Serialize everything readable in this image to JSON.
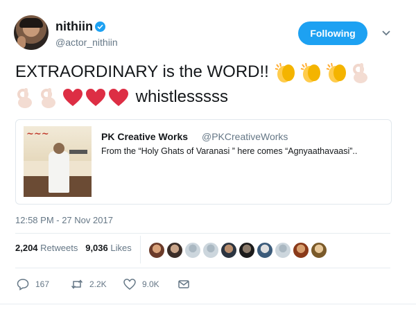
{
  "author": {
    "display_name": "nithiin",
    "handle": "@actor_nithiin",
    "verified": true,
    "avatar_icon": "avatar"
  },
  "follow_button": {
    "label": "Following",
    "color": "#1da1f2"
  },
  "more_menu_icon": "chevron-down-icon",
  "tweet": {
    "line1_text": "EXTRAORDINARY is the WORD!!",
    "line2_text": "whistlesssss",
    "emojis": [
      "clapping-hands",
      "clapping-hands",
      "clapping-hands",
      "ok-hand",
      "ok-hand",
      "ok-hand",
      "red-heart",
      "red-heart",
      "red-heart"
    ]
  },
  "quoted_tweet": {
    "name": "PK Creative Works",
    "handle": "@PKCreativeWorks",
    "text": "From the “Holy Ghats of Varanasi ” here comes “Agnyaathavaasi”..",
    "image_icon": "movie-poster-thumbnail"
  },
  "timestamp": "12:58 PM - 27 Nov 2017",
  "stats": {
    "retweets_count": "2,204",
    "retweets_label": "Retweets",
    "likes_count": "9,036",
    "likes_label": "Likes",
    "liker_avatars": 10
  },
  "actions": {
    "reply_count": "167",
    "retweet_count": "2.2K",
    "like_count": "9.0K",
    "reply_icon": "reply-icon",
    "retweet_icon": "retweet-icon",
    "like_icon": "heart-icon",
    "dm_icon": "envelope-icon"
  },
  "colors": {
    "accent": "#1da1f2",
    "text": "#14171a",
    "secondary_text": "#657786",
    "heart_emoji": "#dd2e44",
    "clap_emoji": "#ffcc4d"
  }
}
